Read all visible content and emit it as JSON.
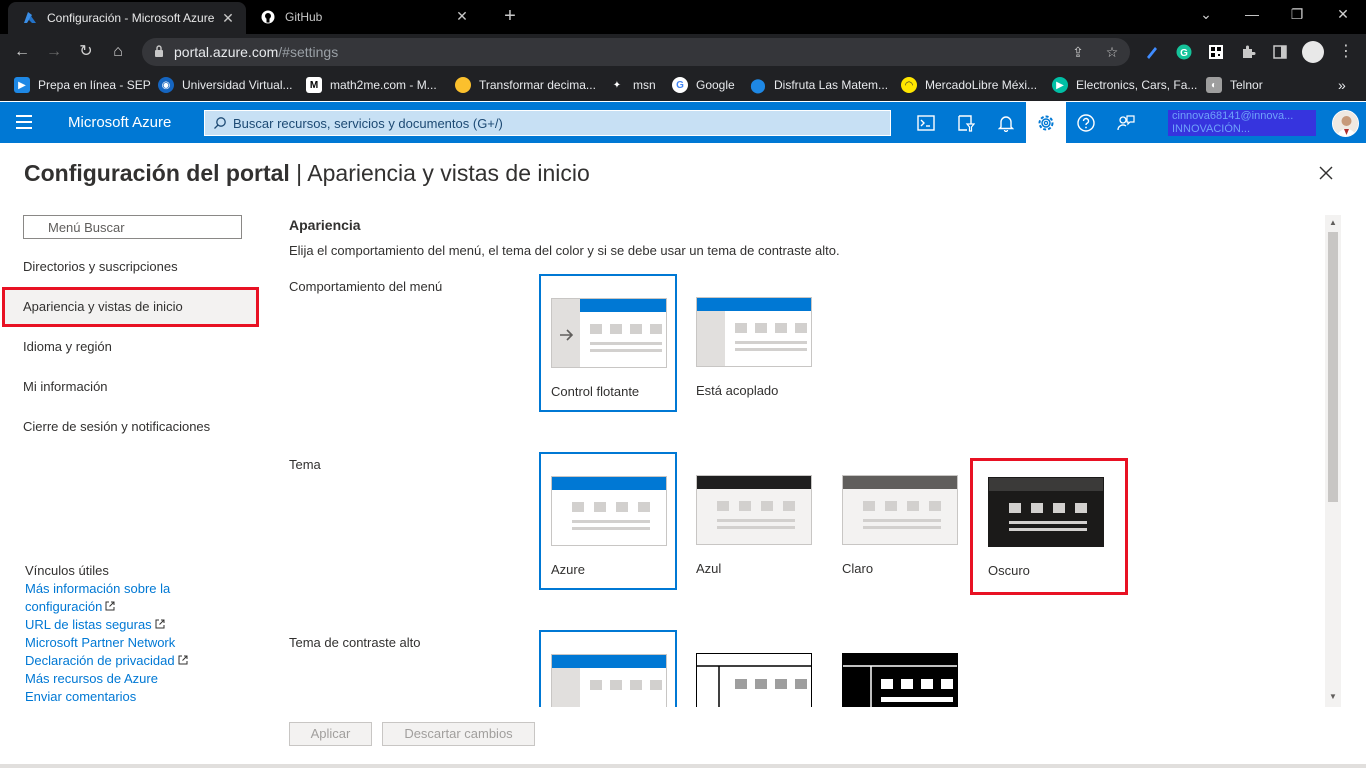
{
  "browser": {
    "tabs": [
      {
        "title": "Configuración - Microsoft Azure",
        "active": true
      },
      {
        "title": "GitHub",
        "active": false
      }
    ],
    "url_host": "portal.azure.com",
    "url_path": "/#settings",
    "bookmarks": [
      {
        "label": "Prepa en línea - SEP",
        "color": "#1e88e5"
      },
      {
        "label": "Universidad Virtual...",
        "color": "#1565c0"
      },
      {
        "label": "math2me.com - M...",
        "color": "#ffffff"
      },
      {
        "label": "Transformar decima...",
        "color": "#fbc02d"
      },
      {
        "label": "msn",
        "color": "#ffffff"
      },
      {
        "label": "Google",
        "color": "#ffffff"
      },
      {
        "label": "Disfruta Las Matem...",
        "color": "#1e88e5"
      },
      {
        "label": "MercadoLibre Méxi...",
        "color": "#ffe600"
      },
      {
        "label": "Electronics, Cars, Fa...",
        "color": "#00bfa5"
      },
      {
        "label": "Telnor",
        "color": "#9e9e9e"
      }
    ]
  },
  "azure": {
    "brand": "Microsoft Azure",
    "search_placeholder": "Buscar recursos, servicios y documentos (G+/)",
    "account_line1": "cinnova68141@innova...",
    "account_line2": "INNOVACIÓN... MICROSOFT..."
  },
  "blade": {
    "title_main": "Configuración del portal",
    "title_sep": " | ",
    "title_sub": "Apariencia y vistas de inicio"
  },
  "nav": {
    "search_placeholder": "Menú Buscar",
    "items": [
      {
        "label": "Directorios y suscripciones",
        "active": false
      },
      {
        "label": "Apariencia y vistas de inicio",
        "active": true
      },
      {
        "label": "Idioma y región",
        "active": false
      },
      {
        "label": "Mi información",
        "active": false
      },
      {
        "label": "Cierre de sesión y notificaciones",
        "active": false
      }
    ]
  },
  "links": {
    "heading": "Vínculos útiles",
    "items": [
      {
        "label": "Más información sobre la",
        "external": false
      },
      {
        "label": "configuración",
        "external": true
      },
      {
        "label": "URL de listas seguras",
        "external": true
      },
      {
        "label": "Microsoft Partner Network",
        "external": false
      },
      {
        "label": "Declaración de privacidad",
        "external": true
      },
      {
        "label": "Más recursos de Azure",
        "external": false
      },
      {
        "label": "Enviar comentarios",
        "external": false
      }
    ]
  },
  "appearance": {
    "title": "Apariencia",
    "description": "Elija el comportamiento del menú, el tema del color y si se debe usar un tema de contraste alto.",
    "menu_behavior_label": "Comportamiento del menú",
    "menu_options": [
      {
        "label": "Control flotante",
        "selected": true
      },
      {
        "label": "Está acoplado",
        "selected": false
      }
    ],
    "theme_label": "Tema",
    "themes": [
      {
        "label": "Azure",
        "selected": true
      },
      {
        "label": "Azul",
        "selected": false
      },
      {
        "label": "Claro",
        "selected": false
      },
      {
        "label": "Oscuro",
        "selected": false,
        "highlighted": true
      }
    ],
    "contrast_label": "Tema de contraste alto"
  },
  "buttons": {
    "apply": "Aplicar",
    "discard": "Descartar cambios"
  },
  "colors": {
    "azure_blue": "#0078d4",
    "highlight_red": "#e81123"
  }
}
